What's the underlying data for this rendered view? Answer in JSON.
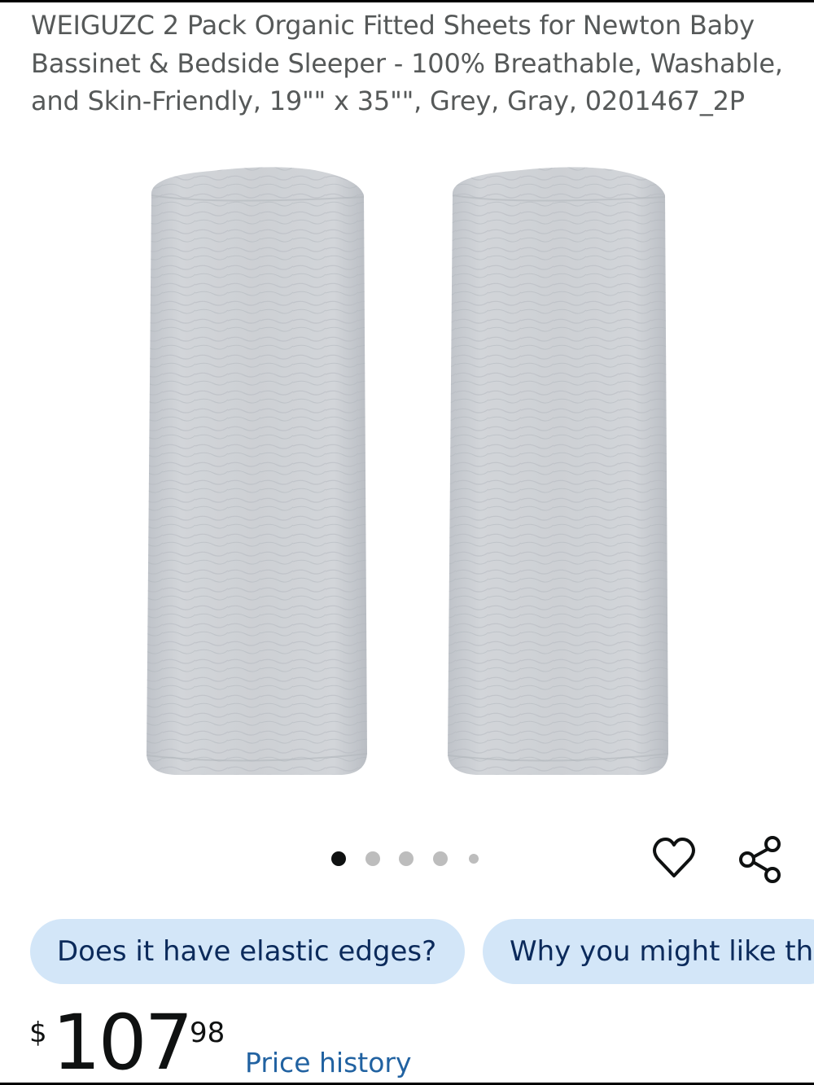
{
  "product": {
    "title": "WEIGUZC 2 Pack Organic Fitted Sheets for Newton Baby Bassinet & Bedside Sleeper - 100% Breathable, Washable, and Skin-Friendly, 19\"\" x 35\"\", Grey, Gray, 0201467_2P",
    "image_color": "#c9ccd1"
  },
  "carousel": {
    "total": 5,
    "active_index": 0
  },
  "actions": {
    "favorite_icon": "heart-icon",
    "share_icon": "share-icon"
  },
  "questions": [
    {
      "label": "Does it have elastic edges?"
    },
    {
      "label": "Why you might like this"
    }
  ],
  "price": {
    "symbol": "$",
    "whole": "107",
    "fraction": "98",
    "history_label": "Price history"
  },
  "colors": {
    "chip_bg": "#d3e6f8",
    "chip_text": "#0b2a5b",
    "link": "#2162a1",
    "text": "#565959"
  }
}
